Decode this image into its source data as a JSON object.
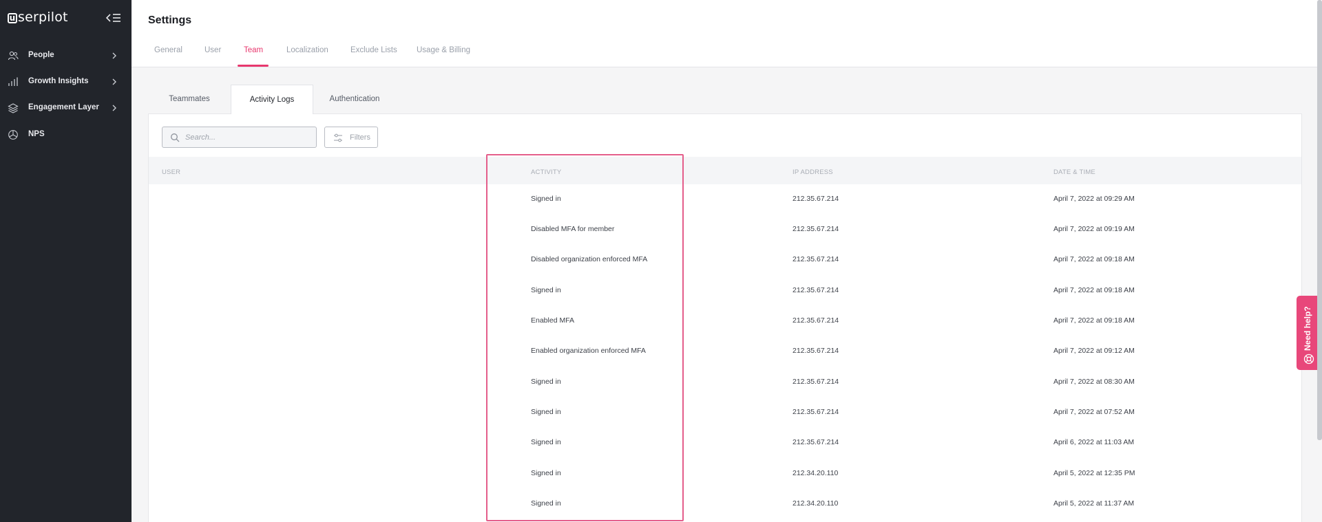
{
  "app": {
    "logo_text": "serpilot",
    "logo_mark": "u"
  },
  "sidebar": {
    "items": [
      {
        "label": "People",
        "icon": "people-icon"
      },
      {
        "label": "Growth Insights",
        "icon": "bar-chart-icon"
      },
      {
        "label": "Engagement Layer",
        "icon": "layers-icon"
      },
      {
        "label": "NPS",
        "icon": "pie-icon"
      }
    ]
  },
  "header": {
    "title": "Settings",
    "tabs": [
      {
        "label": "General"
      },
      {
        "label": "User"
      },
      {
        "label": "Team"
      },
      {
        "label": "Localization"
      },
      {
        "label": "Exclude Lists"
      },
      {
        "label": "Usage & Billing"
      }
    ],
    "active_tab": "Team"
  },
  "subtabs": [
    {
      "label": "Teammates"
    },
    {
      "label": "Activity Logs"
    },
    {
      "label": "Authentication"
    }
  ],
  "active_subtab": "Activity Logs",
  "toolbar": {
    "search_placeholder": "Search...",
    "filters_label": "Filters"
  },
  "table": {
    "columns": [
      "USER",
      "ACTIVITY",
      "IP ADDRESS",
      "DATE & TIME"
    ],
    "rows": [
      {
        "user": "",
        "activity": "Signed in",
        "ip": "212.35.67.214",
        "datetime": "April 7, 2022 at 09:29 AM"
      },
      {
        "user": "",
        "activity": "Disabled MFA for member",
        "ip": "212.35.67.214",
        "datetime": "April 7, 2022 at 09:19 AM"
      },
      {
        "user": "",
        "activity": "Disabled organization enforced MFA",
        "ip": "212.35.67.214",
        "datetime": "April 7, 2022 at 09:18 AM"
      },
      {
        "user": "",
        "activity": "Signed in",
        "ip": "212.35.67.214",
        "datetime": "April 7, 2022 at 09:18 AM"
      },
      {
        "user": "",
        "activity": "Enabled MFA",
        "ip": "212.35.67.214",
        "datetime": "April 7, 2022 at 09:18 AM"
      },
      {
        "user": "",
        "activity": "Enabled organization enforced MFA",
        "ip": "212.35.67.214",
        "datetime": "April 7, 2022 at 09:12 AM"
      },
      {
        "user": "",
        "activity": "Signed in",
        "ip": "212.35.67.214",
        "datetime": "April 7, 2022 at 08:30 AM"
      },
      {
        "user": "",
        "activity": "Signed in",
        "ip": "212.35.67.214",
        "datetime": "April 7, 2022 at 07:52 AM"
      },
      {
        "user": "",
        "activity": "Signed in",
        "ip": "212.35.67.214",
        "datetime": "April 6, 2022 at 11:03 AM"
      },
      {
        "user": "",
        "activity": "Signed in",
        "ip": "212.34.20.110",
        "datetime": "April 5, 2022 at 12:35 PM"
      },
      {
        "user": "",
        "activity": "Signed in",
        "ip": "212.34.20.110",
        "datetime": "April 5, 2022 at 11:37 AM"
      }
    ]
  },
  "help_widget": {
    "label": "Need help?"
  },
  "colors": {
    "accent": "#e8386e",
    "sidebar_bg": "#22252b",
    "highlight_border": "#e45d8a"
  }
}
